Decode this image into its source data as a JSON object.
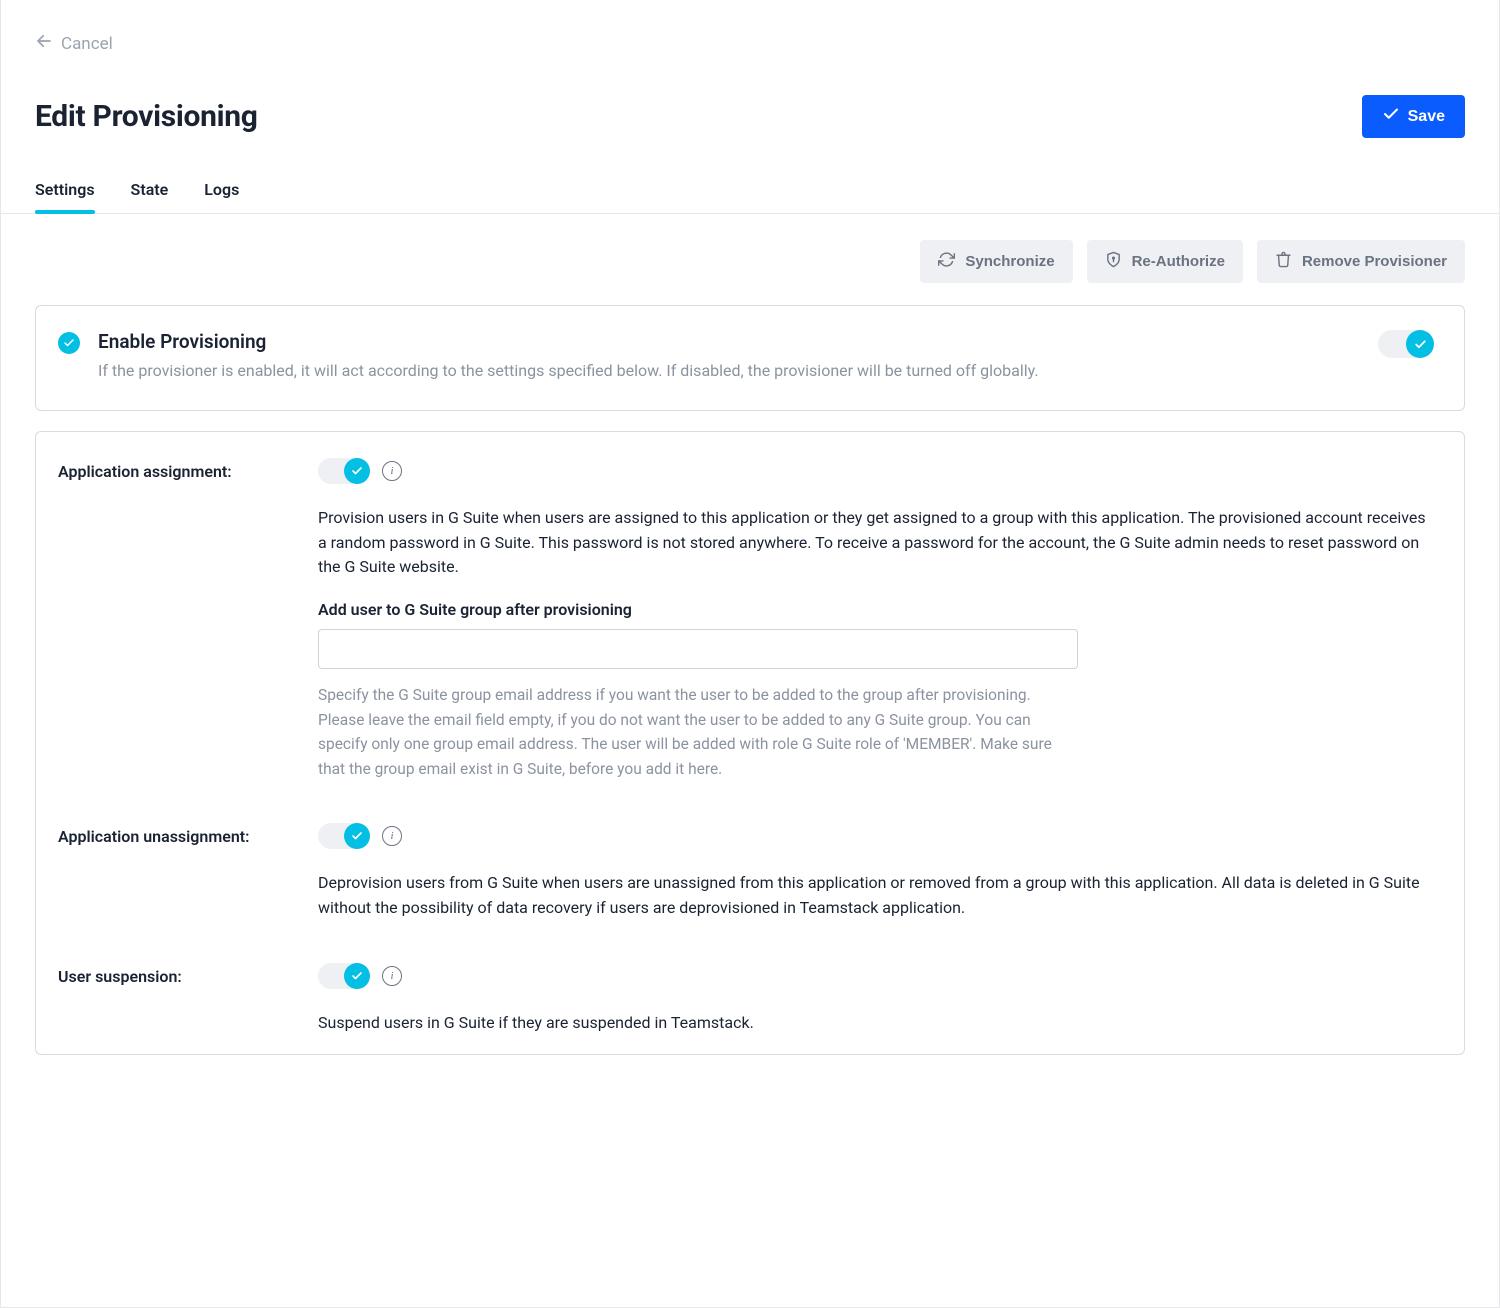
{
  "header": {
    "cancel_label": "Cancel",
    "title": "Edit Provisioning",
    "save_label": "Save"
  },
  "tabs": {
    "settings": "Settings",
    "state": "State",
    "logs": "Logs",
    "active": "settings"
  },
  "actions": {
    "synchronize": "Synchronize",
    "reauthorize": "Re-Authorize",
    "remove": "Remove Provisioner"
  },
  "enable": {
    "title": "Enable Provisioning",
    "desc": "If the provisioner is enabled, it will act according to the settings specified below. If disabled, the provisioner will be turned off globally.",
    "on": true
  },
  "settings": {
    "app_assignment": {
      "label": "Application assignment:",
      "on": true,
      "desc": "Provision users in G Suite when users are assigned to this application or they get assigned to a group with this application. The provisioned account receives a random password in G Suite. This password is not stored anywhere. To receive a password for the account, the G Suite admin needs to reset password on the G Suite website.",
      "group_heading": "Add user to G Suite group after provisioning",
      "group_value": "",
      "group_hint": "Specify the G Suite group email address if you want the user to be added to the group after provisioning. Please leave the email field empty, if you do not want the user to be added to any G Suite group. You can specify only one group email address. The user will be added with role G Suite role of 'MEMBER'. Make sure that the group email exist in G Suite, before you add it here."
    },
    "app_unassignment": {
      "label": "Application unassignment:",
      "on": true,
      "desc": "Deprovision users from G Suite when users are unassigned from this application or removed from a group with this application. All data is deleted in G Suite without the possibility of data recovery if users are deprovisioned in Teamstack application."
    },
    "user_suspension": {
      "label": "User suspension:",
      "on": true,
      "desc": "Suspend users in G Suite if they are suspended in Teamstack."
    }
  },
  "colors": {
    "accent_cyan": "#04bfe4",
    "primary_blue": "#0a5cff"
  }
}
